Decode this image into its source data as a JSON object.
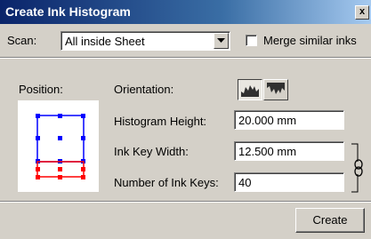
{
  "window": {
    "title": "Create Ink Histogram",
    "close_glyph": "x"
  },
  "scan": {
    "label": "Scan:",
    "selected": "All inside Sheet"
  },
  "merge": {
    "label": "Merge similar inks",
    "checked": false
  },
  "position": {
    "label": "Position:"
  },
  "orientation": {
    "label": "Orientation:",
    "selected": "upright-histogram-icon"
  },
  "fields": {
    "histogram_height": {
      "label": "Histogram Height:",
      "value": "20.000 mm"
    },
    "ink_key_width": {
      "label": "Ink Key Width:",
      "value": "12.500 mm"
    },
    "number_of_ink_keys": {
      "label": "Number of Ink Keys:",
      "value": "40"
    }
  },
  "buttons": {
    "create": "Create"
  },
  "colors": {
    "title_start": "#0a246a",
    "title_end": "#a6caf0",
    "sheet_outline": "#0000ff",
    "histogram_outline": "#ff0000",
    "background": "#d4d0c8"
  }
}
